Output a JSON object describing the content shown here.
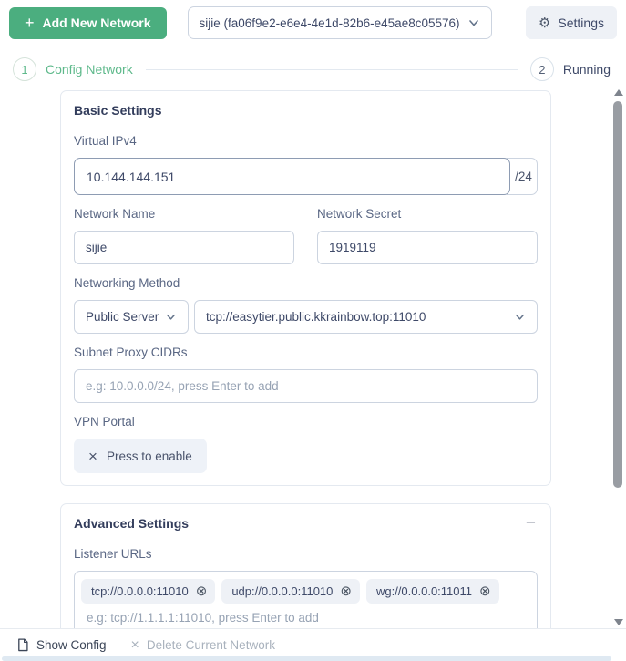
{
  "topbar": {
    "add_button_label": "Add New Network",
    "network_select_value": "sijie (fa06f9e2-e6e4-4e1d-82b6-e45ae8c05576)",
    "settings_button_label": "Settings"
  },
  "stepper": {
    "step1": {
      "number": "1",
      "label": "Config Network"
    },
    "step2": {
      "number": "2",
      "label": "Running"
    }
  },
  "basic": {
    "title": "Basic Settings",
    "virtual_ipv4": {
      "label": "Virtual IPv4",
      "value": "10.144.144.151",
      "suffix": "/24"
    },
    "network_name": {
      "label": "Network Name",
      "value": "sijie"
    },
    "network_secret": {
      "label": "Network Secret",
      "value": "1919119"
    },
    "networking_method": {
      "label": "Networking Method",
      "method_value": "Public Server",
      "server_value": "tcp://easytier.public.kkrainbow.top:11010"
    },
    "subnet_proxy": {
      "label": "Subnet Proxy CIDRs",
      "placeholder": "e.g: 10.0.0.0/24, press Enter to add"
    },
    "vpn_portal": {
      "label": "VPN Portal",
      "button_label": "Press to enable"
    }
  },
  "advanced": {
    "title": "Advanced Settings",
    "listener_urls": {
      "label": "Listener URLs",
      "chips": [
        "tcp://0.0.0.0:11010",
        "udp://0.0.0.0:11010",
        "wg://0.0.0.0:11011"
      ],
      "placeholder": "e.g: tcp://1.1.1.1:11010, press Enter to add"
    }
  },
  "footer": {
    "show_config_label": "Show Config",
    "delete_network_label": "Delete Current Network"
  },
  "icons": {
    "plus": "+",
    "gear": "⚙",
    "times": "×",
    "chip_remove": "⊗",
    "collapse_minus": "−"
  },
  "colors": {
    "accent_green": "#4bae7f",
    "step_active_green": "#5eb98b",
    "border_light": "#e4e9f0",
    "border_input": "#ccd4e0",
    "text_dark": "#3e4968",
    "text_muted": "#97a3b4",
    "chip_bg": "#eef1f6"
  }
}
